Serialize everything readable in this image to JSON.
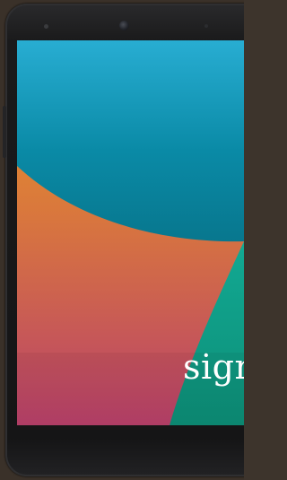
{
  "screen": {
    "login_text": "sign",
    "wallpaper_colors": {
      "teal_top": "#24a9cf",
      "teal_deep": "#0a7f97",
      "orange": "#e89a2a",
      "pink": "#c0486a",
      "green": "#12a18a"
    }
  },
  "device": {
    "body_color": "#151516"
  }
}
